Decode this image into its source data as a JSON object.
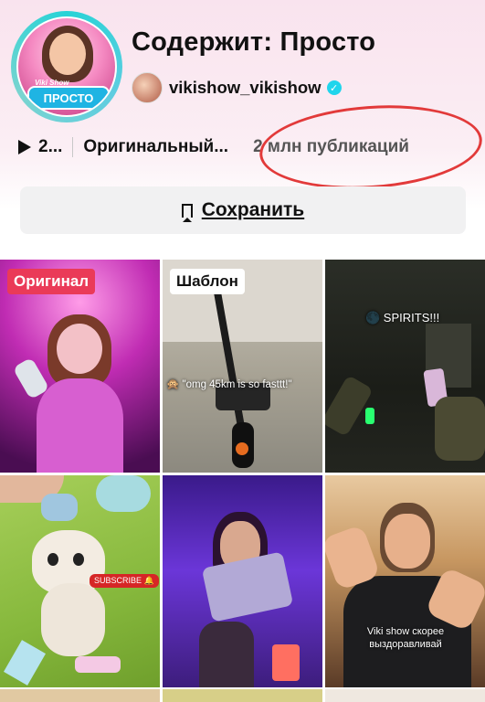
{
  "header": {
    "avatar_badge": "ПРОСТО",
    "avatar_badge_sub": "Viki Show",
    "title": "Содержит: Просто",
    "author": "vikishow_vikishow",
    "verified_glyph": "✓"
  },
  "meta": {
    "plays": "2...",
    "sound_name": "Оригинальный...",
    "publications": "2 млн публикаций"
  },
  "save_button": {
    "label": "Сохранить",
    "icon": "bookmark-icon"
  },
  "grid": {
    "items": [
      {
        "tag": "Оригинал",
        "overlay": ""
      },
      {
        "tag": "Шаблон",
        "overlay": "🙊 \"omg 45km is so fasttt!\""
      },
      {
        "tag": "",
        "overlay": "🌑 SPIRITS!!!"
      },
      {
        "tag": "",
        "overlay": "SUBSCRIBE 🔔"
      },
      {
        "tag": "",
        "overlay": ""
      },
      {
        "tag": "",
        "overlay": "Viki show скорее выздоравливай"
      }
    ]
  },
  "colors": {
    "accent_circle": "#e23a3a",
    "verified": "#20d5ec",
    "tag_red": "#ea3a58"
  }
}
